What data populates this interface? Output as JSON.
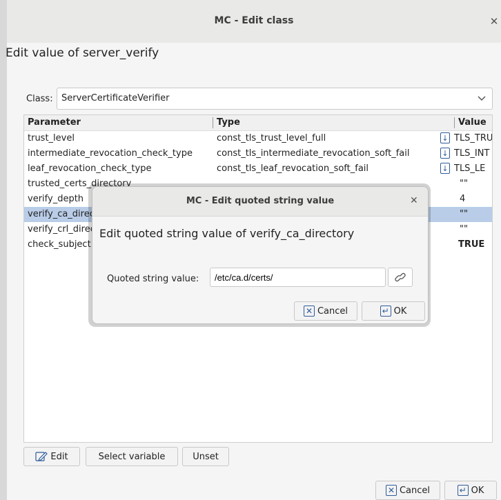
{
  "window": {
    "title": "MC - Edit class",
    "close_glyph": "✕",
    "heading": "Edit value of server_verify"
  },
  "class_selector": {
    "label": "Class:",
    "value": "ServerCertificateVerifier",
    "arrow_glyph": "⌄"
  },
  "table": {
    "columns": [
      "Parameter",
      "Type",
      "Value"
    ],
    "rows": [
      {
        "param": "trust_level",
        "type": "const_tls_trust_level_full",
        "value": "TLS_TRU",
        "icon": "↓"
      },
      {
        "param": "intermediate_revocation_check_type",
        "type": "const_tls_intermediate_revocation_soft_fail",
        "value": "TLS_INT",
        "icon": "↓"
      },
      {
        "param": "leaf_revocation_check_type",
        "type": "const_tls_leaf_revocation_soft_fail",
        "value": "TLS_LE",
        "icon": "↓"
      },
      {
        "param": "trusted_certs_directory",
        "type": "",
        "value": "\"\"",
        "icon": ""
      },
      {
        "param": "verify_depth",
        "type": "",
        "value": "4",
        "icon": ""
      },
      {
        "param": "verify_ca_directory",
        "type": "",
        "value": "\"\"",
        "icon": ""
      },
      {
        "param": "verify_crl_directory",
        "type": "",
        "value": "\"\"",
        "icon": ""
      },
      {
        "param": "check_subject",
        "type": "",
        "value": "TRUE",
        "icon": ""
      }
    ]
  },
  "bottom_buttons": {
    "edit_label": "Edit",
    "select_variable_label": "Select variable",
    "unset_label": "Unset",
    "cancel_label": "Cancel",
    "ok_label": "OK",
    "cancel_glyph": "✕",
    "ok_glyph": "↵"
  },
  "dialog": {
    "title": "MC - Edit quoted string value",
    "close_glyph": "✕",
    "heading": "Edit quoted string value of verify_ca_directory",
    "field_label": "Quoted string value:",
    "field_value": "/etc/ca.d/certs/",
    "link_icon": "link-icon",
    "cancel_label": "Cancel",
    "ok_label": "OK",
    "cancel_glyph": "✕",
    "ok_glyph": "↵"
  },
  "colors": {
    "selection": "#b9cde8",
    "accent_icon": "#2f5b9a"
  }
}
